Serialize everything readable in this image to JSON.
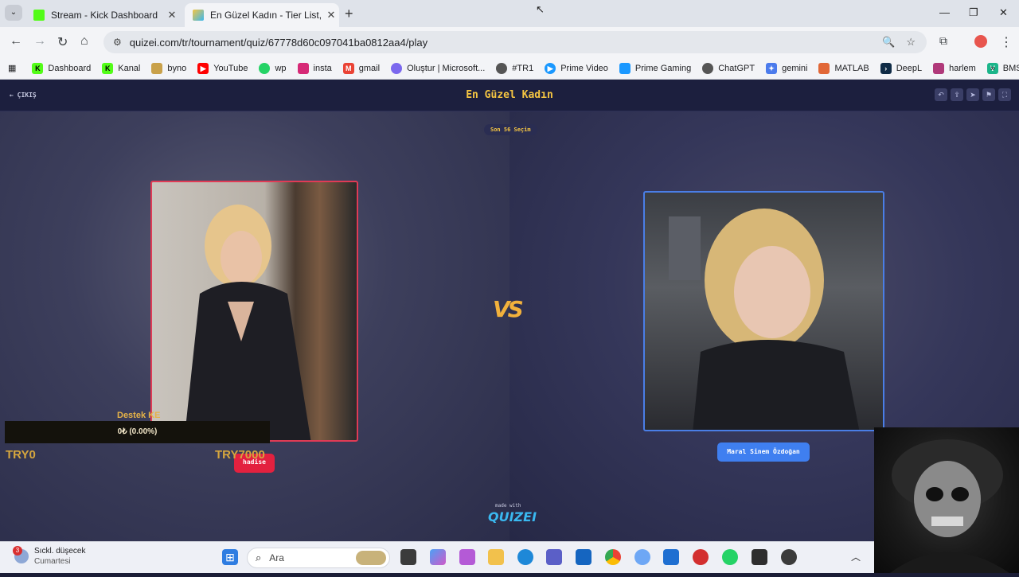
{
  "browser": {
    "tabs": [
      {
        "title": "Stream - Kick Dashboard",
        "active": false
      },
      {
        "title": "En Güzel Kadın - Tier List, Kör S",
        "active": true
      }
    ],
    "url": "quizei.com/tr/tournament/quiz/67778d60c097041ba0812aa4/play",
    "bookmarks": [
      "Dashboard",
      "Kanal",
      "byno",
      "YouTube",
      "wp",
      "insta",
      "gmail",
      "Oluştur | Microsoft...",
      "#TR1",
      "Prime Video",
      "Prime Gaming",
      "ChatGPT",
      "gemini",
      "MATLAB",
      "DeepL",
      "harlem",
      "BMS"
    ]
  },
  "quiz": {
    "exit_label": "ÇIKIŞ",
    "title": "En Güzel Kadın",
    "remaining": "Son 56 Seçim",
    "vs": "VS",
    "left_choice": "hadise",
    "right_choice": "Maral Sinem Özdoğan",
    "made_with": "made with",
    "brand": "QUIZEI"
  },
  "donation_overlay": {
    "label": "Destek KE",
    "bar_text": "0₺ (0.00%)",
    "min": "TRY0",
    "max": "TRY7000"
  },
  "taskbar": {
    "weather_title": "Sıckl. düşecek",
    "weather_sub": "Cumartesi",
    "weather_badge": "3",
    "search_placeholder": "Ara"
  },
  "colors": {
    "accent_title": "#f5c542",
    "left_button": "#e3213f",
    "right_button": "#3f7ff0",
    "left_border": "#e03b55",
    "right_border": "#4a7ee6"
  }
}
